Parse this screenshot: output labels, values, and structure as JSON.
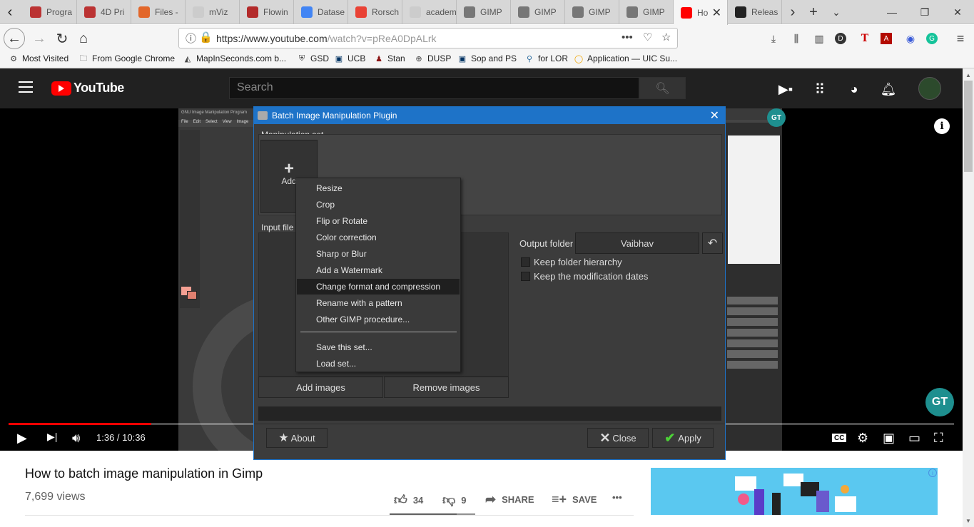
{
  "browser": {
    "tabs": [
      {
        "label": "Progra",
        "color": "#b33"
      },
      {
        "label": "4D Pri",
        "color": "#b33"
      },
      {
        "label": "Files -",
        "color": "#e2672a"
      },
      {
        "label": "mViz",
        "color": "#cccccc"
      },
      {
        "label": "Flowin",
        "color": "#b32a2a"
      },
      {
        "label": "Datase",
        "color": "#4285f4"
      },
      {
        "label": "Rorsch",
        "color": "#e94235"
      },
      {
        "label": "academy.",
        "color": "#cccccc"
      },
      {
        "label": "GIMP",
        "color": "#777"
      },
      {
        "label": "GIMP",
        "color": "#777"
      },
      {
        "label": "GIMP",
        "color": "#777"
      },
      {
        "label": "GIMP",
        "color": "#777"
      },
      {
        "label": "Ho",
        "color": "#ff0000"
      },
      {
        "label": "Releas",
        "color": "#222"
      }
    ],
    "url_domain": "https://www.youtube.com",
    "url_path": "/watch?v=pReA0DpALrk",
    "bookmarks": [
      {
        "label": "Most Visited",
        "icon": "gear-icon"
      },
      {
        "label": "From Google Chrome",
        "icon": "folder-icon"
      },
      {
        "label": "MapInSeconds.com b...",
        "icon": "map-icon"
      },
      {
        "label": "GSD",
        "icon": "shield-icon"
      },
      {
        "label": "UCB",
        "icon": "cal-icon"
      },
      {
        "label": "Stan",
        "icon": "person-icon"
      },
      {
        "label": "DUSP",
        "icon": "globe-icon"
      },
      {
        "label": "Sop and PS",
        "icon": "cal-icon"
      },
      {
        "label": "for LOR",
        "icon": "pin-icon"
      },
      {
        "label": "Application — UIC Su...",
        "icon": "circle-icon"
      }
    ]
  },
  "youtube": {
    "logo_text": "YouTube",
    "search_placeholder": "Search",
    "time_display": "1:36 / 10:36",
    "progress_fraction": 0.151,
    "video_title": "How to batch image manipulation in Gimp",
    "views": "7,699 views",
    "likes": "34",
    "dislikes": "9",
    "share_label": "SHARE",
    "save_label": "SAVE",
    "more_label": "•••",
    "gt_badge": "GT",
    "info_label": "i"
  },
  "gimp": {
    "window_title": "GNU Image Manipulation Program",
    "menus": [
      "File",
      "Edit",
      "Select",
      "View",
      "Image"
    ]
  },
  "dialog": {
    "title": "Batch Image Manipulation Plugin",
    "manipulation_set_label": "Manipulation set",
    "add_label": "Add",
    "input_files_label": "Input file",
    "output_folder_label": "Output folder",
    "output_folder_value": "Vaibhav",
    "keep_hierarchy": "Keep folder hierarchy",
    "keep_dates": "Keep the modification dates",
    "add_images": "Add images",
    "remove_images": "Remove images",
    "about": "About",
    "close": "Close",
    "apply": "Apply",
    "menu_items": [
      "Resize",
      "Crop",
      "Flip or Rotate",
      "Color correction",
      "Sharp or Blur",
      "Add a Watermark",
      "Change format and compression",
      "Rename with a pattern",
      "Other GIMP procedure..."
    ],
    "menu_items_after_sep": [
      "Save this set...",
      "Load set..."
    ],
    "highlighted_index": 6
  }
}
